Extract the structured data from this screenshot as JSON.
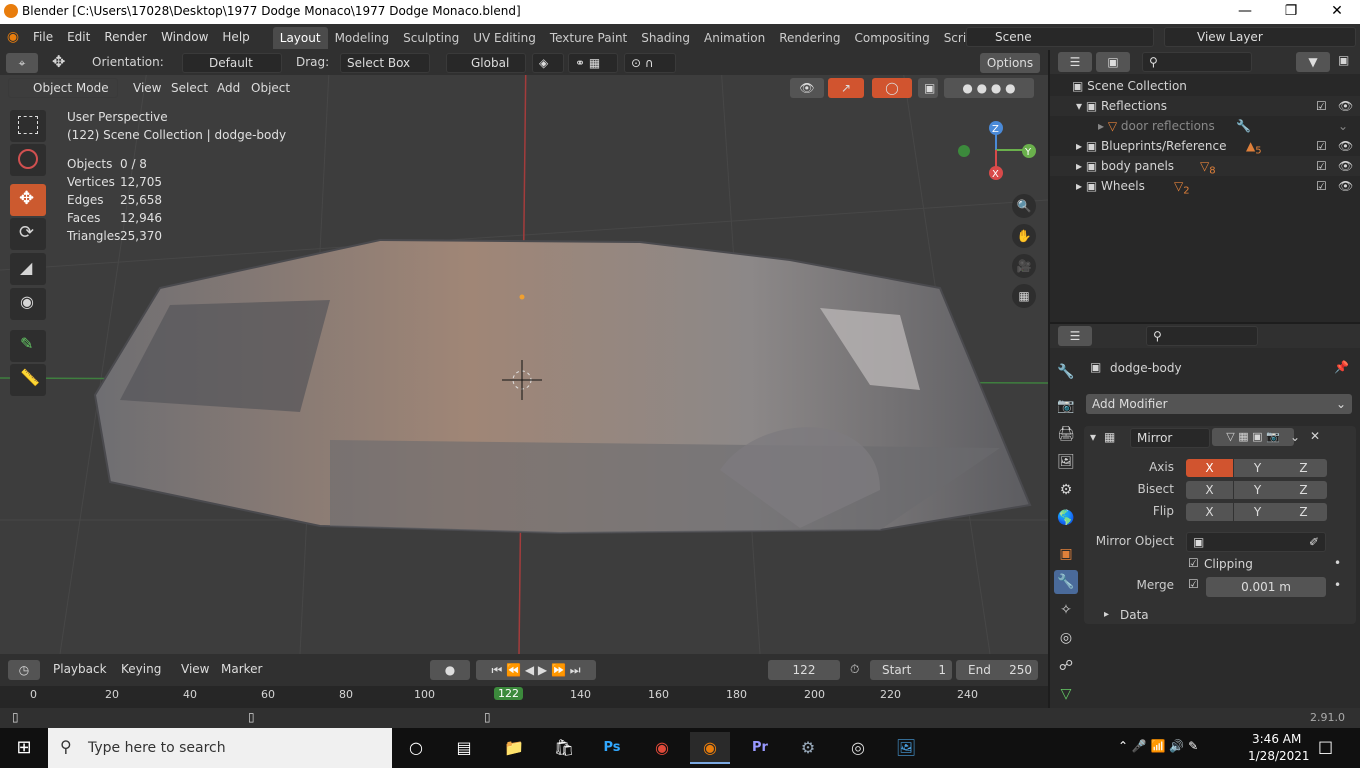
{
  "title": "Blender [C:\\Users\\17028\\Desktop\\1977 Dodge Monaco\\1977 Dodge Monaco.blend]",
  "menu": [
    "File",
    "Edit",
    "Render",
    "Window",
    "Help"
  ],
  "workspaces": [
    "Layout",
    "Modeling",
    "Sculpting",
    "UV Editing",
    "Texture Paint",
    "Shading",
    "Animation",
    "Rendering",
    "Compositing",
    "Scripting"
  ],
  "scene": "Scene",
  "view_layer": "View Layer",
  "tool_header": {
    "orientation_label": "Orientation:",
    "orientation": "Default",
    "drag_label": "Drag:",
    "drag": "Select Box",
    "transform": "Global",
    "options": "Options"
  },
  "view_header": {
    "mode": "Object Mode",
    "menus": [
      "View",
      "Select",
      "Add",
      "Object"
    ]
  },
  "overlay": {
    "perspective": "User Perspective",
    "collection": "(122) Scene Collection | dodge-body",
    "stats": [
      {
        "label": "Objects",
        "value": "0 / 8"
      },
      {
        "label": "Vertices",
        "value": "12,705"
      },
      {
        "label": "Edges",
        "value": "25,658"
      },
      {
        "label": "Faces",
        "value": "12,946"
      },
      {
        "label": "Triangles",
        "value": "25,370"
      }
    ]
  },
  "gizmo": {
    "z": "Z",
    "y": "Y",
    "x": "X"
  },
  "outliner": {
    "root": "Scene Collection",
    "items": [
      {
        "name": "Reflections",
        "badge": ""
      },
      {
        "name": "door reflections",
        "badge": ""
      },
      {
        "name": "Blueprints/Reference",
        "badge": "5"
      },
      {
        "name": "body panels",
        "badge": "8"
      },
      {
        "name": "Wheels",
        "badge": "2"
      }
    ]
  },
  "properties": {
    "object": "dodge-body",
    "add_modifier": "Add Modifier",
    "modifier": "Mirror",
    "axis_label": "Axis",
    "bisect_label": "Bisect",
    "flip_label": "Flip",
    "xyz": [
      "X",
      "Y",
      "Z"
    ],
    "mirror_object_label": "Mirror Object",
    "clipping": "Clipping",
    "merge_label": "Merge",
    "merge_value": "0.001 m",
    "data_label": "Data"
  },
  "timeline": {
    "menus": [
      "Playback",
      "Keying",
      "View",
      "Marker"
    ],
    "current_frame": "122",
    "start_label": "Start",
    "start": "1",
    "end_label": "End",
    "end": "250",
    "ticks": [
      "0",
      "20",
      "40",
      "60",
      "80",
      "100",
      "122",
      "140",
      "160",
      "180",
      "200",
      "220",
      "240"
    ]
  },
  "version": "2.91.0",
  "taskbar": {
    "search": "Type here to search",
    "time": "3:46 AM",
    "date": "1/28/2021"
  },
  "colors": {
    "accent": "#d1542f",
    "active_tab": "#4b4b4b",
    "viewport": "#3d3d3d"
  }
}
